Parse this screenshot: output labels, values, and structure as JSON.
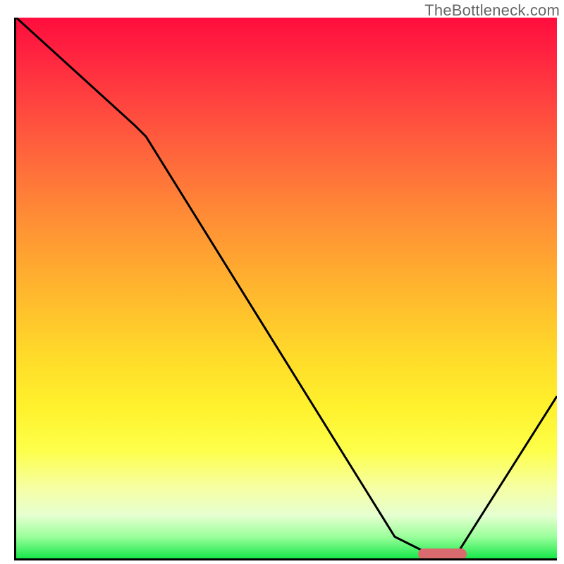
{
  "watermark": "TheBottleneck.com",
  "colors": {
    "gradient_top": "#ff0d3e",
    "gradient_bottom": "#17e84a",
    "curve": "#000000",
    "marker": "#d96b6e",
    "axis": "#000000"
  },
  "chart_data": {
    "type": "line",
    "title": "",
    "xlabel": "",
    "ylabel": "",
    "xlim": [
      0,
      100
    ],
    "ylim": [
      0,
      100
    ],
    "x": [
      0,
      22,
      24,
      70,
      78,
      81,
      100
    ],
    "values": [
      100,
      80,
      78,
      4,
      0,
      0,
      30
    ],
    "marker": {
      "x_start": 74,
      "x_end": 83,
      "y": 1.2
    },
    "annotations": []
  }
}
